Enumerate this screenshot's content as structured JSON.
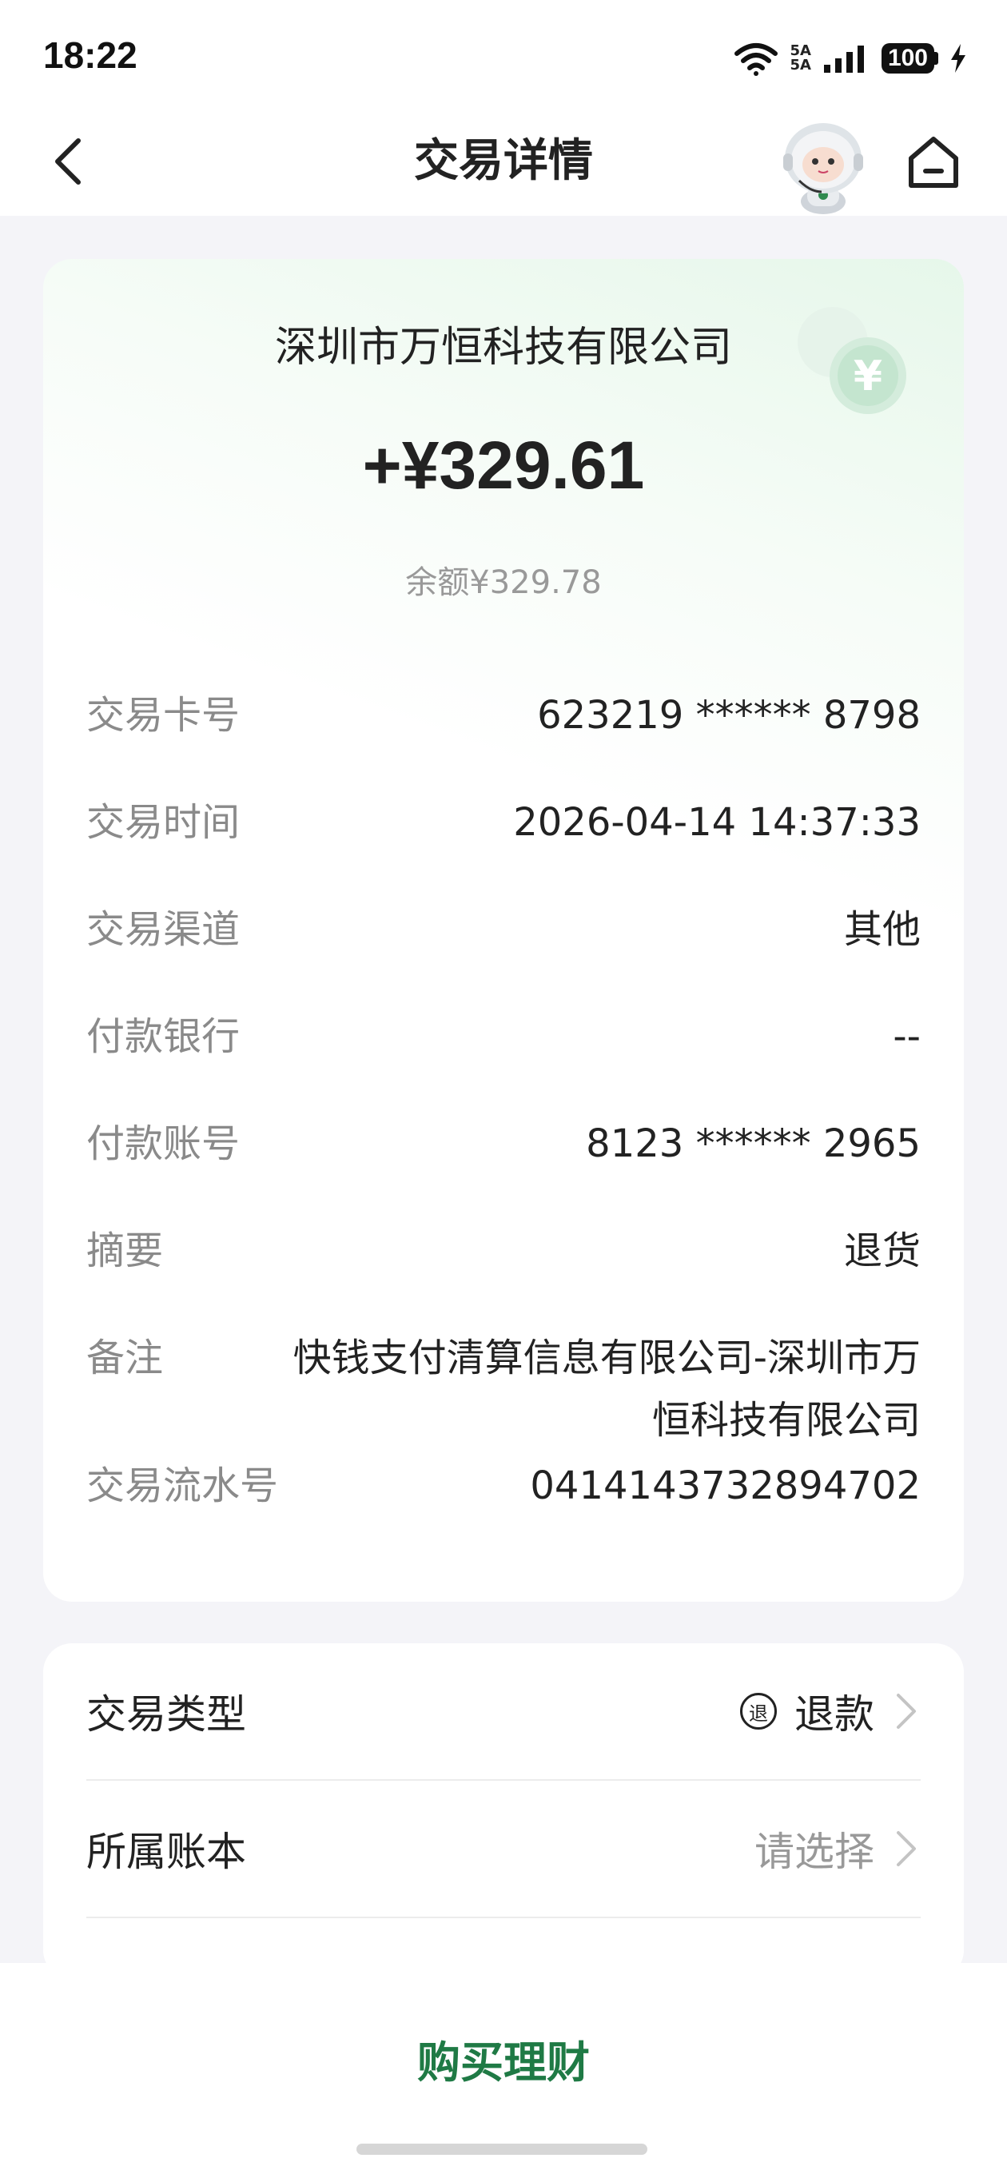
{
  "status_bar": {
    "time": "18:22",
    "network_top": "5A",
    "network_bottom": "5A",
    "battery": "100"
  },
  "header": {
    "title": "交易详情"
  },
  "transaction": {
    "merchant": "深圳市万恒科技有限公司",
    "amount": "+¥329.61",
    "balance": "余额¥329.78",
    "rows": [
      {
        "label": "交易卡号",
        "value": "623219 ****** 8798"
      },
      {
        "label": "交易时间",
        "value": "2026-04-14 14:37:33"
      },
      {
        "label": "交易渠道",
        "value": "其他"
      },
      {
        "label": "付款银行",
        "value": "--"
      },
      {
        "label": "付款账号",
        "value": "8123 ****** 2965"
      },
      {
        "label": "摘要",
        "value": "退货"
      },
      {
        "label": "备注",
        "value": "快钱支付清算信息有限公司-深圳市万恒科技有限公司"
      },
      {
        "label": "交易流水号",
        "value": "0414143732894702"
      }
    ]
  },
  "settings": {
    "type_label": "交易类型",
    "type_badge": "退",
    "type_value": "退款",
    "book_label": "所属账本",
    "book_value": "请选择"
  },
  "bottom": {
    "buy_label": "购买理财"
  },
  "colors": {
    "accent": "#1f7a45",
    "background": "#f4f4f8",
    "label_gray": "#8a8a8a"
  }
}
